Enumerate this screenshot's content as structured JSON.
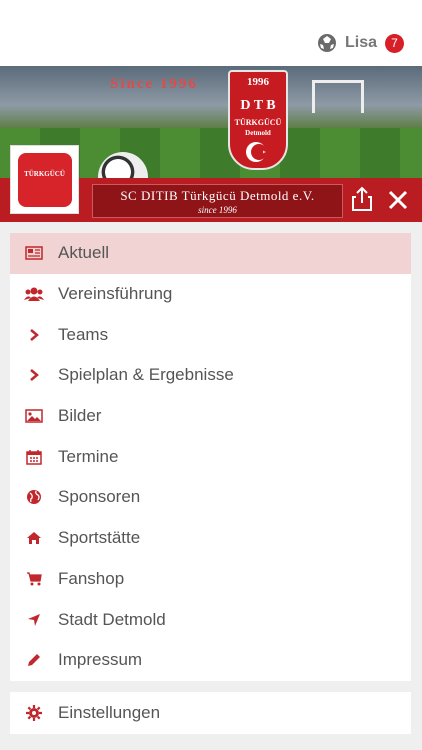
{
  "header": {
    "user_name": "Lisa",
    "notification_count": "7"
  },
  "banner": {
    "since_text": "Since 1996",
    "crest_letters": "D T B",
    "crest_name": "TÜRKGÜCÜ",
    "crest_city": "Detmold",
    "crest_year": "1996"
  },
  "club": {
    "name": "SC DITIB Türkgücü Detmold e.V.",
    "since": "since 1996"
  },
  "menu": {
    "items": [
      {
        "label": "Aktuell",
        "icon": "newspaper-icon"
      },
      {
        "label": "Vereinsführung",
        "icon": "users-icon"
      },
      {
        "label": "Teams",
        "icon": "chevron-right-icon"
      },
      {
        "label": "Spielplan & Ergebnisse",
        "icon": "chevron-right-icon"
      },
      {
        "label": "Bilder",
        "icon": "image-icon"
      },
      {
        "label": "Termine",
        "icon": "calendar-icon"
      },
      {
        "label": "Sponsoren",
        "icon": "globe-icon"
      },
      {
        "label": "Sportstätte",
        "icon": "home-icon"
      },
      {
        "label": "Fanshop",
        "icon": "cart-icon"
      },
      {
        "label": "Stadt Detmold",
        "icon": "location-arrow-icon"
      },
      {
        "label": "Impressum",
        "icon": "pencil-icon"
      }
    ],
    "settings_label": "Einstellungen"
  },
  "colors": {
    "accent": "#c0282d",
    "active_bg": "#f2d3d4",
    "bar": "#b91c21"
  }
}
